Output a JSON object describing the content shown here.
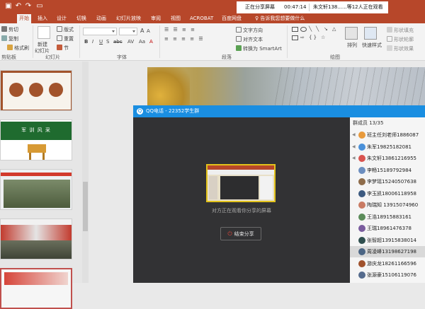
{
  "titlebar": {
    "qat_icons": [
      "save-icon",
      "undo-icon",
      "redo-icon",
      "start-from-beginning-icon"
    ]
  },
  "sharing": {
    "status": "正在分享屏幕",
    "timer": "00:47:14",
    "viewers": "朱文轩138......等12人正在观看"
  },
  "tabs": [
    "开始",
    "插入",
    "设计",
    "切换",
    "动画",
    "幻灯片放映",
    "审阅",
    "视图",
    "ACROBAT",
    "百度网盘"
  ],
  "active_tab": "开始",
  "tellme": "♀ 告诉我您想要做什么",
  "ribbon": {
    "clipboard": {
      "cut": "剪切",
      "copy": "复制",
      "format_painter": "格式刷",
      "label": "剪贴板"
    },
    "slides": {
      "new_slide": "新建",
      "new_slide2": "幻灯片",
      "layout": "版式",
      "reset": "重置",
      "section": "节",
      "label": "幻灯片"
    },
    "font": {
      "label": "字体"
    },
    "paragraph": {
      "text_direction": "文字方向",
      "align_text": "对齐文本",
      "smartart": "转换为 SmartArt",
      "label": "段落"
    },
    "drawing": {
      "arrange": "排列",
      "quick_styles": "快速样式",
      "shape_fill": "形状填充",
      "shape_outline": "形状轮廓",
      "shape_effects": "形状效果",
      "label": "绘图"
    }
  },
  "slide_thumbs": [
    {
      "index": "1",
      "title": ""
    },
    {
      "index": "2",
      "title": "军 训 风 采"
    },
    {
      "index": "3",
      "title": ""
    },
    {
      "index": "4",
      "title": ""
    },
    {
      "index": "5",
      "title": ""
    }
  ],
  "qq": {
    "title": "QQ电话 - 22352学生群",
    "share_caption": "对方正在观看你分享的屏幕",
    "end_share": "结束分享",
    "members_header": "群成员 13/35",
    "members": [
      {
        "name": "班主任刘老师1886087",
        "speaking": true,
        "color": "#e89a3c"
      },
      {
        "name": "朱军19825182081",
        "speaking": true,
        "color": "#4a90d9"
      },
      {
        "name": "朱文轩13861216955",
        "speaking": true,
        "color": "#d9534f"
      },
      {
        "name": "李畅15189792984",
        "speaking": false,
        "color": "#6c8ebf"
      },
      {
        "name": "李梦瑶15240507638",
        "speaking": false,
        "color": "#8e6c4a"
      },
      {
        "name": "李玉凯18006118958",
        "speaking": false,
        "color": "#3d5a80"
      },
      {
        "name": "陶瑞知 13915074960",
        "speaking": false,
        "color": "#c97b63"
      },
      {
        "name": "王浩18915883161",
        "speaking": false,
        "color": "#5b8c5a"
      },
      {
        "name": "王瑞18961476378",
        "speaking": false,
        "color": "#7a5c9e"
      },
      {
        "name": "张智超13915838014",
        "speaking": false,
        "color": "#2f4f4f"
      },
      {
        "name": "周凌峰13198627198",
        "speaking": false,
        "color": "#4b6584",
        "highlight": true
      },
      {
        "name": "游庆龙18261166596",
        "speaking": false,
        "color": "#a0522d"
      },
      {
        "name": "张源豪15106119076",
        "speaking": false,
        "color": "#556b8d"
      }
    ]
  },
  "colors": {
    "ppt_red": "#b7472a",
    "qq_blue": "#1a8ee1",
    "preview_border": "#e2c21b",
    "end_icon": "#e0463a"
  }
}
